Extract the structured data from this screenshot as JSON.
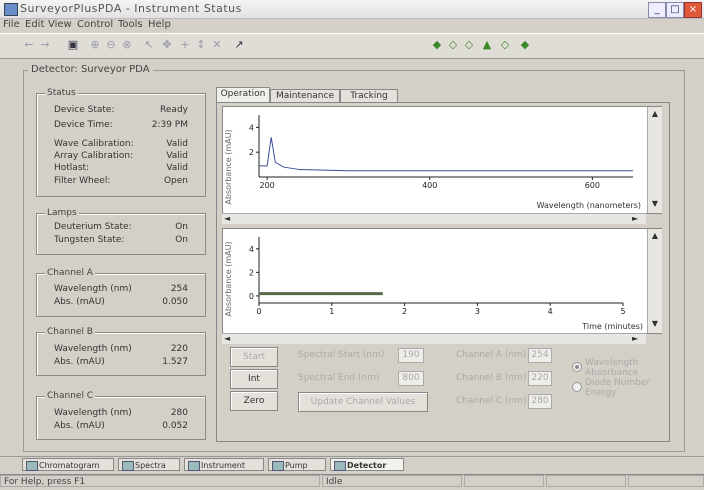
{
  "window": {
    "title": "SurveyorPlusPDA - Instrument Status"
  },
  "menu": [
    "File",
    "Edit",
    "View",
    "Control",
    "Tools",
    "Help"
  ],
  "detector": {
    "group_title": "Detector: Surveyor PDA",
    "status": {
      "title": "Status",
      "rows": [
        {
          "label": "Device State:",
          "value": "Ready"
        },
        {
          "label": "Device Time:",
          "value": "2:39 PM"
        },
        {
          "label": "Wave Calibration:",
          "value": "Valid"
        },
        {
          "label": "Array Calibration:",
          "value": "Valid"
        },
        {
          "label": "Hotlast:",
          "value": "Valid"
        },
        {
          "label": "Filter Wheel:",
          "value": "Open"
        }
      ]
    },
    "lamps": {
      "title": "Lamps",
      "rows": [
        {
          "label": "Deuterium State:",
          "value": "On"
        },
        {
          "label": "Tungsten State:",
          "value": "On"
        }
      ]
    },
    "channels": [
      {
        "title": "Channel A",
        "rows": [
          {
            "label": "Wavelength (nm)",
            "value": "254"
          },
          {
            "label": "Abs. (mAU)",
            "value": "0.050"
          }
        ]
      },
      {
        "title": "Channel B",
        "rows": [
          {
            "label": "Wavelength (nm)",
            "value": "220"
          },
          {
            "label": "Abs. (mAU)",
            "value": "1.527"
          }
        ]
      },
      {
        "title": "Channel C",
        "rows": [
          {
            "label": "Wavelength (nm)",
            "value": "280"
          },
          {
            "label": "Abs. (mAU)",
            "value": "0.052"
          }
        ]
      }
    ]
  },
  "tabs": [
    "Operation",
    "Maintenance",
    "Tracking"
  ],
  "chart_data": [
    {
      "type": "line",
      "ylabel": "Absorbance (mAU)",
      "xlabel": "Wavelength (nanometers)",
      "x_ticks": [
        "200",
        "400",
        "600"
      ],
      "y_ticks": [
        "4",
        "2"
      ],
      "series": [
        {
          "x": [
            190,
            200,
            205,
            210,
            220,
            240,
            300,
            400,
            500,
            600,
            650
          ],
          "y": [
            0.9,
            0.9,
            3.2,
            1.2,
            0.8,
            0.6,
            0.5,
            0.5,
            0.5,
            0.5,
            0.5
          ]
        }
      ]
    },
    {
      "type": "line",
      "ylabel": "Absorbance (mAU)",
      "xlabel": "Time (minutes)",
      "x_ticks": [
        "0",
        "1",
        "2",
        "3",
        "4",
        "5"
      ],
      "y_ticks": [
        "4",
        "2",
        "0"
      ],
      "series": [
        {
          "x": [
            0,
            0.5,
            1.0,
            1.5,
            1.7
          ],
          "y": [
            0.2,
            0.2,
            0.2,
            0.2,
            0.2
          ]
        }
      ]
    }
  ],
  "controls": {
    "start_btn": "Start",
    "btn2": "Int",
    "zero_btn": "Zero",
    "spectral_start_label": "Spectral Start (nm)",
    "spectral_start_value": "190",
    "spectral_end_label": "Spectral End (nm)",
    "spectral_end_value": "800",
    "update_btn": "Update Channel Values",
    "channel_a_label": "Channel A (nm)",
    "channel_a_value": "254",
    "channel_b_label": "Channel B (nm)",
    "channel_b_value": "220",
    "channel_c_label": "Channel C (nm)",
    "channel_c_value": "280",
    "radio1": "Wavelength Absorbance",
    "radio2": "Diode Number Energy"
  },
  "taskbar": [
    "Chromatogram",
    "Spectra",
    "Instrument",
    "Pump",
    "Detector"
  ],
  "statusbar": {
    "help": "For Help, press F1",
    "state": "Idle"
  }
}
